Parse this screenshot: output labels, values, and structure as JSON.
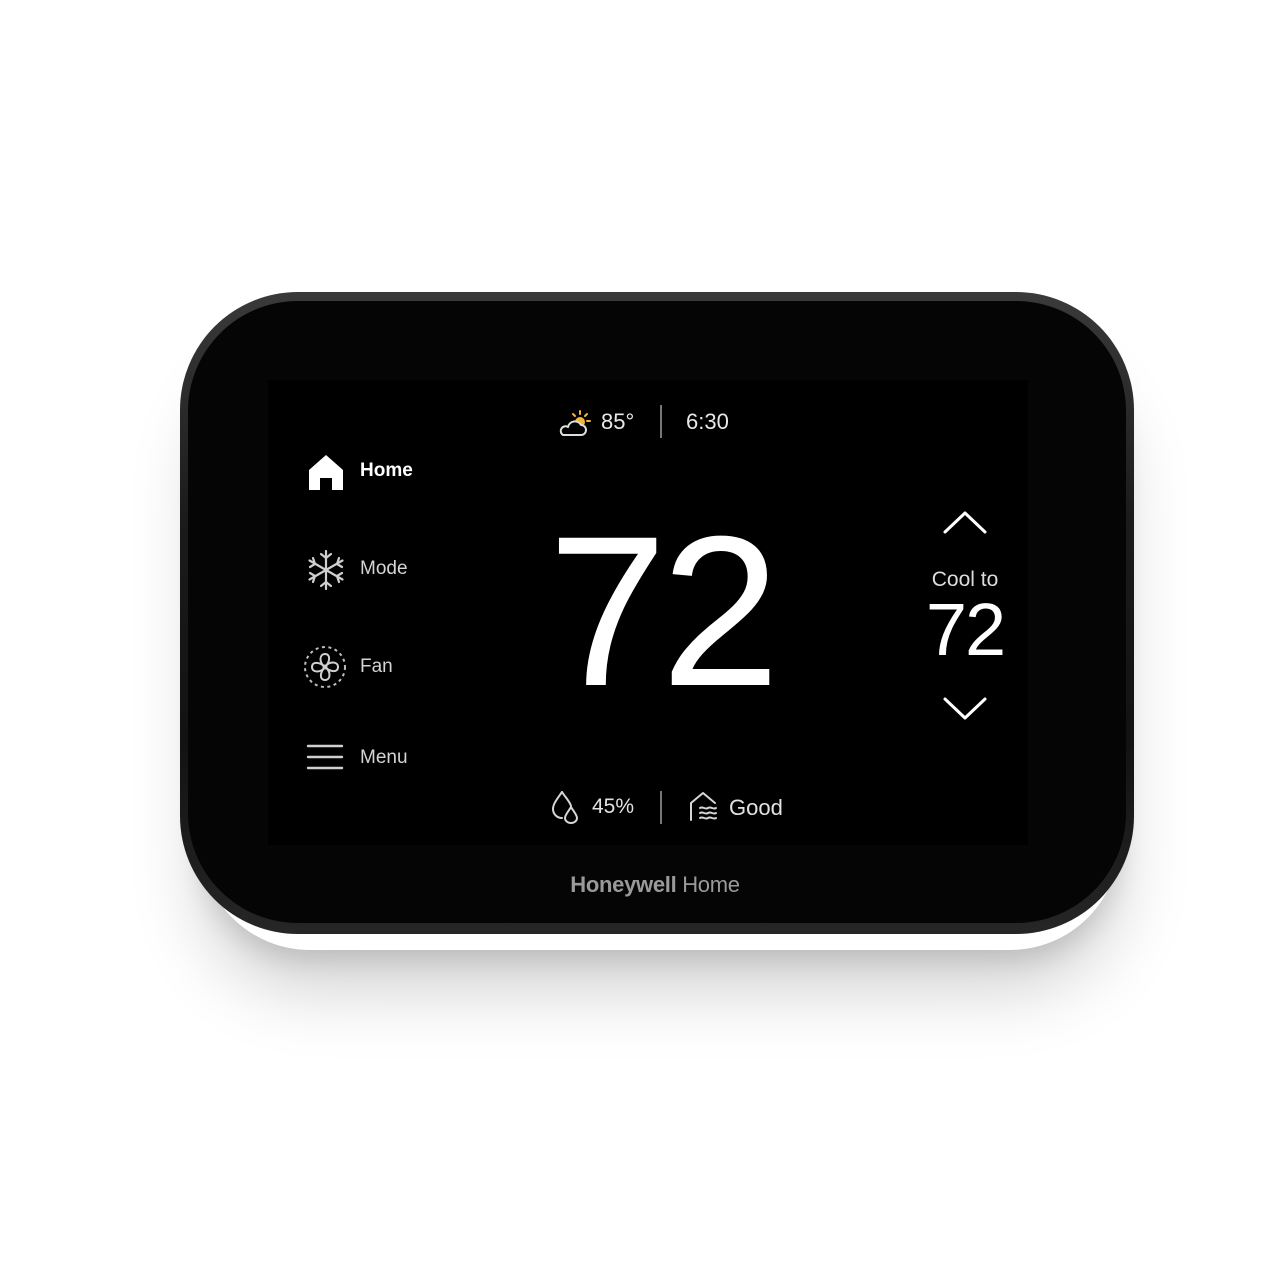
{
  "status_top": {
    "weather_icon": "partly-sunny-icon",
    "outdoor_temp": "85°",
    "time": "6:30"
  },
  "sidebar": {
    "items": [
      {
        "label": "Home",
        "icon": "home-icon",
        "active": true
      },
      {
        "label": "Mode",
        "icon": "snowflake-icon",
        "active": false
      },
      {
        "label": "Fan",
        "icon": "fan-icon",
        "active": false
      },
      {
        "label": "Menu",
        "icon": "hamburger-menu-icon",
        "active": false
      }
    ]
  },
  "main": {
    "indoor_temp": "72"
  },
  "setpoint": {
    "label": "Cool to",
    "value": "72",
    "up_icon": "chevron-up-icon",
    "down_icon": "chevron-down-icon"
  },
  "status_bottom": {
    "humidity_icon": "humidity-icon",
    "humidity": "45%",
    "air_icon": "air-quality-icon",
    "air_quality": "Good"
  },
  "brand": {
    "bold": "Honeywell",
    "light": " Home"
  },
  "colors": {
    "screen": "#000000",
    "text": "#ffffff",
    "sun": "#f2b43a",
    "logo": "#9a9a9a"
  }
}
